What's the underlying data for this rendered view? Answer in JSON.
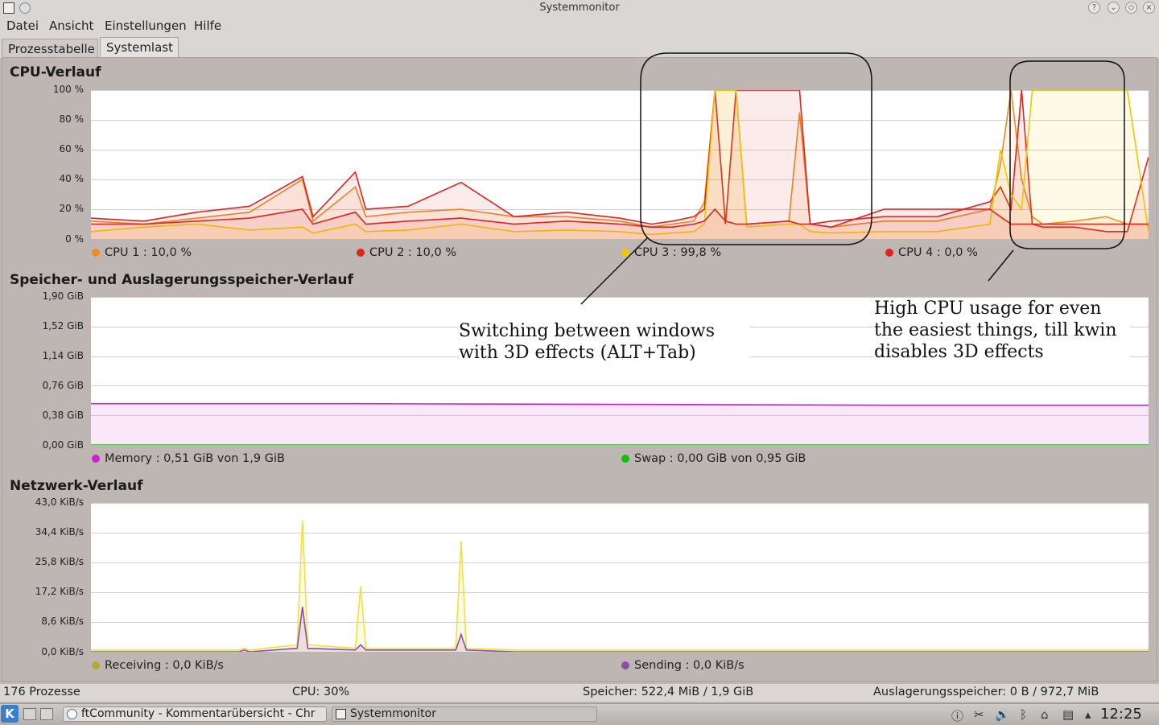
{
  "window": {
    "title": "Systemmonitor"
  },
  "menu": [
    "Datei",
    "Ansicht",
    "Einstellungen",
    "Hilfe"
  ],
  "tabs": [
    "Prozesstabelle",
    "Systemlast"
  ],
  "active_tab": "Systemlast",
  "colors": {
    "cpu1": "#f08a24",
    "cpu2": "#e0241c",
    "cpu3": "#f4c400",
    "cpu4": "#e0241c",
    "memory": "#cc20cc",
    "swap": "#10c010",
    "receiving": "#b8a832",
    "sending": "#8a50a8"
  },
  "cpu": {
    "title": "CPU-Verlauf",
    "y_ticks": [
      "100 %",
      "80 %",
      "60 %",
      "40 %",
      "20 %",
      "0 %"
    ],
    "legend": [
      {
        "label": "CPU 1 : 10,0 %",
        "color": "#f08a24"
      },
      {
        "label": "CPU 2 : 10,0 %",
        "color": "#e0241c"
      },
      {
        "label": "CPU 3 : 99,8 %",
        "color": "#f4c400"
      },
      {
        "label": "CPU 4 : 0,0 %",
        "color": "#e0241c"
      }
    ]
  },
  "memory": {
    "title": "Speicher- und Auslagerungsspeicher-Verlauf",
    "y_ticks": [
      "1,90 GiB",
      "1,52 GiB",
      "1,14 GiB",
      "0,76 GiB",
      "0,38 GiB",
      "0,00 GiB"
    ],
    "legend": [
      {
        "label": "Memory : 0,51 GiB von 1,9 GiB",
        "color": "#cc20cc"
      },
      {
        "label": "Swap : 0,00 GiB von 0,95 GiB",
        "color": "#10c010"
      }
    ]
  },
  "network": {
    "title": "Netzwerk-Verlauf",
    "y_ticks": [
      "43,0 KiB/s",
      "34,4 KiB/s",
      "25,8 KiB/s",
      "17,2 KiB/s",
      "8,6 KiB/s",
      "0,0 KiB/s"
    ],
    "legend": [
      {
        "label": "Receiving : 0,0 KiB/s",
        "color": "#b8a832"
      },
      {
        "label": "Sending : 0,0 KiB/s",
        "color": "#8a50a8"
      }
    ]
  },
  "annotations": {
    "switching": [
      "Switching between windows",
      "with 3D effects (ALT+Tab)"
    ],
    "high_cpu": [
      "High CPU usage for even",
      "the easiest things, till kwin",
      "disables 3D effects"
    ]
  },
  "status": {
    "processes": "176 Prozesse",
    "cpu": "CPU: 30%",
    "memory": "Speicher: 522,4 MiB / 1,9 GiB",
    "swap": "Auslagerungsspeicher: 0 B / 972,7 MiB"
  },
  "taskbar": {
    "tasks": [
      "ftCommunity - Kommentarübersicht - Chr",
      "Systemmonitor"
    ],
    "clock": "12:25"
  },
  "chart_data": [
    {
      "type": "area",
      "title": "CPU-Verlauf",
      "ylim": [
        0,
        100
      ],
      "y_unit": "%",
      "x": [
        0,
        0.05,
        0.1,
        0.15,
        0.2,
        0.21,
        0.25,
        0.26,
        0.3,
        0.35,
        0.4,
        0.45,
        0.5,
        0.53,
        0.55,
        0.57,
        0.58,
        0.59,
        0.6,
        0.61,
        0.62,
        0.66,
        0.67,
        0.68,
        0.7,
        0.75,
        0.8,
        0.85,
        0.86,
        0.87,
        0.88,
        0.89,
        0.9,
        0.93,
        0.96,
        0.98,
        1.0
      ],
      "series": [
        {
          "name": "CPU 1",
          "values": [
            12,
            10,
            14,
            18,
            40,
            12,
            35,
            15,
            18,
            20,
            15,
            15,
            12,
            8,
            10,
            12,
            25,
            100,
            100,
            100,
            10,
            12,
            85,
            10,
            8,
            12,
            12,
            20,
            50,
            100,
            40,
            15,
            10,
            12,
            15,
            10,
            10
          ]
        },
        {
          "name": "CPU 2",
          "values": [
            14,
            12,
            18,
            22,
            42,
            15,
            45,
            20,
            22,
            38,
            15,
            18,
            14,
            10,
            12,
            15,
            20,
            100,
            10,
            100,
            100,
            100,
            100,
            10,
            12,
            15,
            15,
            25,
            35,
            20,
            100,
            10,
            8,
            8,
            5,
            5,
            55
          ]
        },
        {
          "name": "CPU 3",
          "values": [
            5,
            8,
            10,
            6,
            8,
            4,
            10,
            5,
            6,
            10,
            5,
            6,
            5,
            3,
            4,
            5,
            10,
            100,
            100,
            100,
            8,
            10,
            10,
            5,
            4,
            5,
            5,
            10,
            60,
            30,
            20,
            100,
            100,
            100,
            100,
            100,
            5
          ]
        },
        {
          "name": "CPU 4",
          "values": [
            10,
            10,
            12,
            14,
            20,
            10,
            18,
            10,
            12,
            14,
            10,
            12,
            10,
            8,
            8,
            10,
            12,
            20,
            12,
            10,
            10,
            12,
            10,
            10,
            8,
            20,
            20,
            20,
            15,
            10,
            10,
            10,
            10,
            10,
            10,
            10,
            10
          ]
        }
      ]
    },
    {
      "type": "area",
      "title": "Speicher- und Auslagerungsspeicher-Verlauf",
      "ylim": [
        0,
        1.9
      ],
      "y_unit": "GiB",
      "x": [
        0,
        0.25,
        0.5,
        0.75,
        1.0
      ],
      "series": [
        {
          "name": "Memory",
          "values": [
            0.53,
            0.53,
            0.52,
            0.51,
            0.51
          ]
        },
        {
          "name": "Swap",
          "values": [
            0.0,
            0.0,
            0.0,
            0.0,
            0.0
          ]
        }
      ]
    },
    {
      "type": "area",
      "title": "Netzwerk-Verlauf",
      "ylim": [
        0,
        43
      ],
      "y_unit": "KiB/s",
      "x": [
        0,
        0.14,
        0.145,
        0.15,
        0.195,
        0.2,
        0.205,
        0.25,
        0.255,
        0.26,
        0.345,
        0.35,
        0.355,
        0.4,
        1.0
      ],
      "series": [
        {
          "name": "Receiving",
          "values": [
            0.5,
            0.5,
            1,
            0.5,
            2,
            38,
            2,
            1,
            19,
            1,
            1,
            32,
            1,
            0.5,
            0.5
          ]
        },
        {
          "name": "Sending",
          "values": [
            0,
            0,
            0.5,
            0,
            1,
            13,
            1,
            0.5,
            2,
            0.5,
            0.5,
            5,
            0.5,
            0,
            0
          ]
        }
      ]
    }
  ]
}
